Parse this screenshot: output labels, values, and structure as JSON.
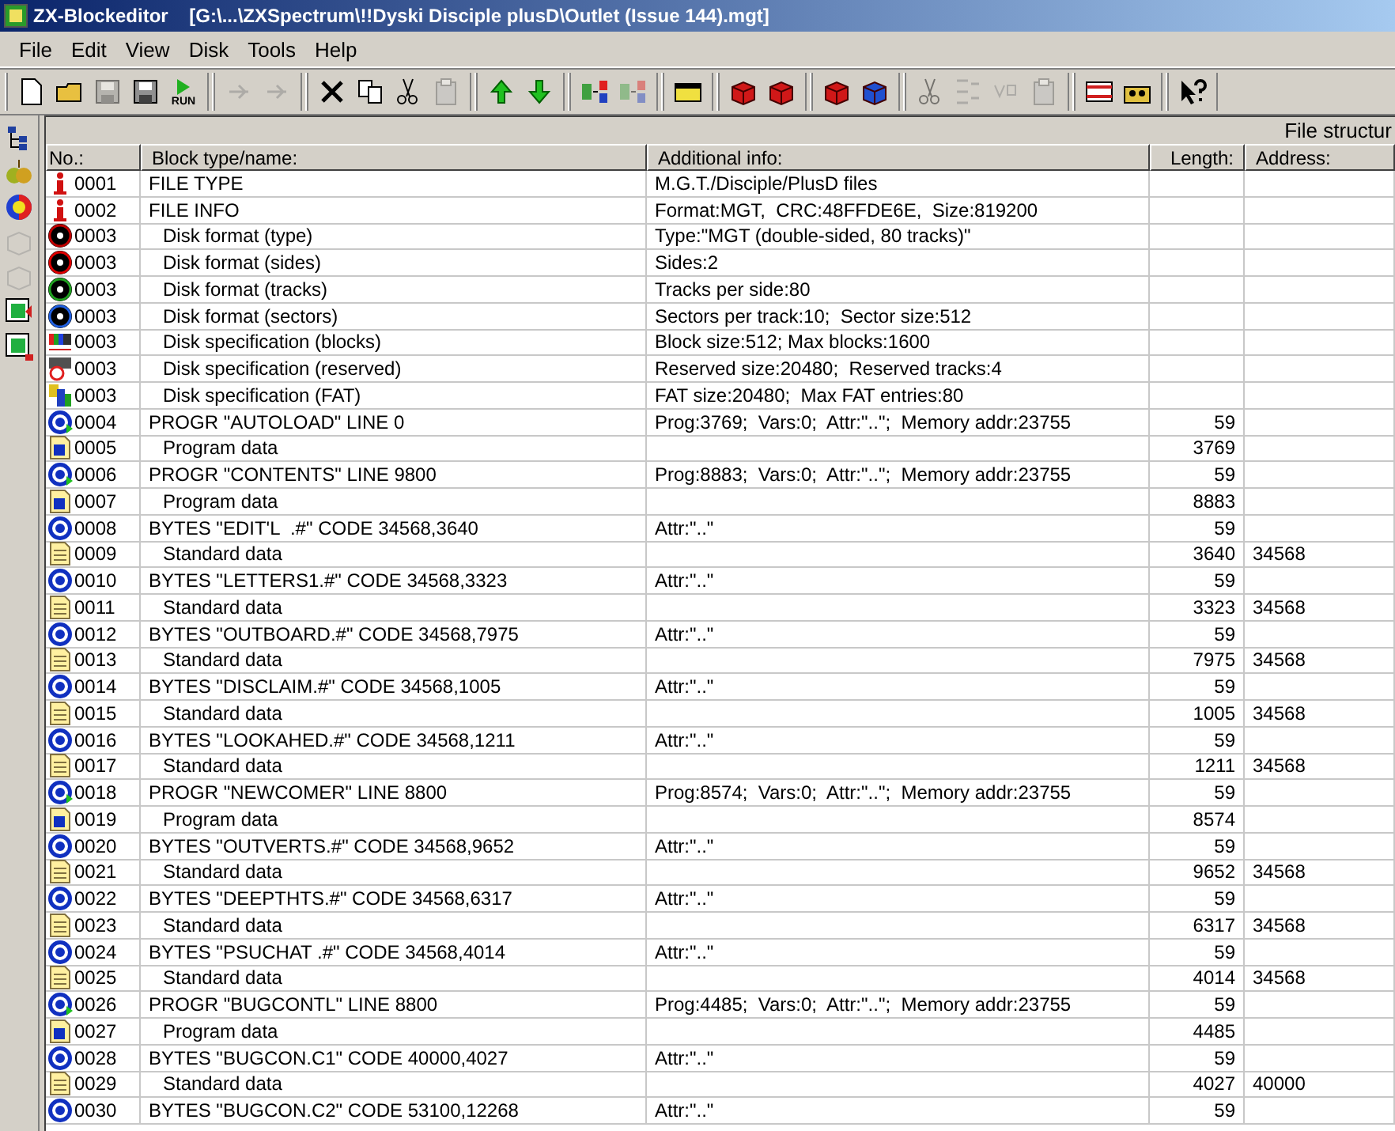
{
  "window": {
    "title": "ZX-Blockeditor    [G:\\...\\ZXSpectrum\\!!Dyski Disciple plusD\\Outlet (Issue 144).mgt]"
  },
  "menu": [
    "File",
    "Edit",
    "View",
    "Disk",
    "Tools",
    "Help"
  ],
  "toolbar": [
    [
      {
        "kind": "new",
        "disabled": false
      },
      {
        "kind": "open",
        "disabled": false
      },
      {
        "kind": "save",
        "disabled": true
      },
      {
        "kind": "save-all",
        "disabled": false
      },
      {
        "kind": "run",
        "label": "RUN",
        "disabled": false
      }
    ],
    [
      {
        "kind": "undo",
        "disabled": true
      },
      {
        "kind": "redo",
        "disabled": true
      }
    ],
    [
      {
        "kind": "delete",
        "disabled": false
      },
      {
        "kind": "copy",
        "disabled": false
      },
      {
        "kind": "cut",
        "disabled": false
      },
      {
        "kind": "paste",
        "disabled": true
      }
    ],
    [
      {
        "kind": "up",
        "disabled": false
      },
      {
        "kind": "down",
        "disabled": false
      }
    ],
    [
      {
        "kind": "split",
        "disabled": false
      },
      {
        "kind": "join",
        "disabled": true
      }
    ],
    [
      {
        "kind": "tape",
        "disabled": false
      }
    ],
    [
      {
        "kind": "box-add",
        "disabled": false
      },
      {
        "kind": "box-clock",
        "disabled": false
      }
    ],
    [
      {
        "kind": "box-edit",
        "disabled": false
      },
      {
        "kind": "box-blue",
        "disabled": false
      }
    ],
    [
      {
        "kind": "cut-clock",
        "disabled": true
      },
      {
        "kind": "list",
        "disabled": true
      },
      {
        "kind": "vo",
        "disabled": true
      },
      {
        "kind": "clip-clock",
        "disabled": true
      }
    ],
    [
      {
        "kind": "ruler",
        "disabled": false
      },
      {
        "kind": "tape2",
        "disabled": false
      }
    ],
    [
      {
        "kind": "help",
        "disabled": false
      }
    ]
  ],
  "left_toolbar": [
    {
      "kind": "tree",
      "disabled": false
    },
    {
      "kind": "pears",
      "disabled": false
    },
    {
      "kind": "ball",
      "disabled": false
    },
    {
      "kind": "box",
      "disabled": true
    },
    {
      "kind": "box",
      "disabled": true
    },
    {
      "kind": "green-in",
      "disabled": false
    },
    {
      "kind": "green-out",
      "disabled": false
    }
  ],
  "panel": {
    "title": "File structur"
  },
  "table": {
    "columns": [
      "No.:",
      "Block type/name:",
      "Additional info:",
      "Length:",
      "Address:"
    ],
    "rows": [
      {
        "kind": "info",
        "no": "0001",
        "name": "FILE TYPE",
        "info": "M.G.T./Disciple/PlusD files"
      },
      {
        "kind": "info",
        "no": "0002",
        "name": "FILE INFO",
        "info": "Format:MGT,  CRC:48FFDE6E,  Size:819200",
        "children": [
          {
            "kind": "disk-type",
            "no": "0003",
            "name": "Disk format (type)",
            "info": "Type:\"MGT (double-sided, 80 tracks)\""
          },
          {
            "kind": "disk-sides",
            "no": "0003",
            "name": "Disk format (sides)",
            "info": "Sides:2"
          },
          {
            "kind": "disk-tracks",
            "no": "0003",
            "name": "Disk format (tracks)",
            "info": "Tracks per side:80"
          },
          {
            "kind": "disk-sectors",
            "no": "0003",
            "name": "Disk format (sectors)",
            "info": "Sectors per track:10;  Sector size:512"
          },
          {
            "kind": "spec-blocks",
            "no": "0003",
            "name": "Disk specification (blocks)",
            "info": "Block size:512; Max blocks:1600"
          },
          {
            "kind": "spec-reserved",
            "no": "0003",
            "name": "Disk specification (reserved)",
            "info": "Reserved size:20480;  Reserved tracks:4"
          },
          {
            "kind": "spec-fat",
            "no": "0003",
            "name": "Disk specification (FAT)",
            "info": "FAT size:20480;  Max FAT entries:80"
          }
        ]
      },
      {
        "kind": "program",
        "no": "0004",
        "name": "PROGR \"AUTOLOAD\" LINE 0",
        "info": "Prog:3769;  Vars:0;  Attr:\"..\";  Memory addr:23755",
        "length": "59",
        "children": [
          {
            "kind": "program-data",
            "no": "0005",
            "name": "Program data",
            "length": "3769"
          }
        ]
      },
      {
        "kind": "program",
        "no": "0006",
        "name": "PROGR \"CONTENTS\" LINE 9800",
        "info": "Prog:8883;  Vars:0;  Attr:\"..\";  Memory addr:23755",
        "length": "59",
        "children": [
          {
            "kind": "program-data",
            "no": "0007",
            "name": "Program data",
            "length": "8883"
          }
        ]
      },
      {
        "kind": "bytes",
        "no": "0008",
        "name": "BYTES \"EDIT'L  .#\" CODE 34568,3640",
        "info": "Attr:\"..\"",
        "length": "59",
        "children": [
          {
            "kind": "data",
            "no": "0009",
            "name": "Standard data",
            "length": "3640",
            "address": "34568"
          }
        ]
      },
      {
        "kind": "bytes",
        "no": "0010",
        "name": "BYTES \"LETTERS1.#\" CODE 34568,3323",
        "info": "Attr:\"..\"",
        "length": "59",
        "children": [
          {
            "kind": "data",
            "no": "0011",
            "name": "Standard data",
            "length": "3323",
            "address": "34568"
          }
        ]
      },
      {
        "kind": "bytes",
        "no": "0012",
        "name": "BYTES \"OUTBOARD.#\" CODE 34568,7975",
        "info": "Attr:\"..\"",
        "length": "59",
        "children": [
          {
            "kind": "data",
            "no": "0013",
            "name": "Standard data",
            "length": "7975",
            "address": "34568"
          }
        ]
      },
      {
        "kind": "bytes",
        "no": "0014",
        "name": "BYTES \"DISCLAIM.#\" CODE 34568,1005",
        "info": "Attr:\"..\"",
        "length": "59",
        "children": [
          {
            "kind": "data",
            "no": "0015",
            "name": "Standard data",
            "length": "1005",
            "address": "34568"
          }
        ]
      },
      {
        "kind": "bytes",
        "no": "0016",
        "name": "BYTES \"LOOKAHED.#\" CODE 34568,1211",
        "info": "Attr:\"..\"",
        "length": "59",
        "children": [
          {
            "kind": "data",
            "no": "0017",
            "name": "Standard data",
            "length": "1211",
            "address": "34568"
          }
        ]
      },
      {
        "kind": "program",
        "no": "0018",
        "name": "PROGR \"NEWCOMER\" LINE 8800",
        "info": "Prog:8574;  Vars:0;  Attr:\"..\";  Memory addr:23755",
        "length": "59",
        "children": [
          {
            "kind": "program-data",
            "no": "0019",
            "name": "Program data",
            "length": "8574"
          }
        ]
      },
      {
        "kind": "bytes",
        "no": "0020",
        "name": "BYTES \"OUTVERTS.#\" CODE 34568,9652",
        "info": "Attr:\"..\"",
        "length": "59",
        "children": [
          {
            "kind": "data",
            "no": "0021",
            "name": "Standard data",
            "length": "9652",
            "address": "34568"
          }
        ]
      },
      {
        "kind": "bytes",
        "no": "0022",
        "name": "BYTES \"DEEPTHTS.#\" CODE 34568,6317",
        "info": "Attr:\"..\"",
        "length": "59",
        "children": [
          {
            "kind": "data",
            "no": "0023",
            "name": "Standard data",
            "length": "6317",
            "address": "34568"
          }
        ]
      },
      {
        "kind": "bytes",
        "no": "0024",
        "name": "BYTES \"PSUCHAT .#\" CODE 34568,4014",
        "info": "Attr:\"..\"",
        "length": "59",
        "children": [
          {
            "kind": "data",
            "no": "0025",
            "name": "Standard data",
            "length": "4014",
            "address": "34568"
          }
        ]
      },
      {
        "kind": "program",
        "no": "0026",
        "name": "PROGR \"BUGCONTL\" LINE 8800",
        "info": "Prog:4485;  Vars:0;  Attr:\"..\";  Memory addr:23755",
        "length": "59",
        "children": [
          {
            "kind": "program-data",
            "no": "0027",
            "name": "Program data",
            "length": "4485"
          }
        ]
      },
      {
        "kind": "bytes",
        "no": "0028",
        "name": "BYTES \"BUGCON.C1\" CODE 40000,4027",
        "info": "Attr:\"..\"",
        "length": "59",
        "children": [
          {
            "kind": "data",
            "no": "0029",
            "name": "Standard data",
            "length": "4027",
            "address": "40000"
          }
        ]
      },
      {
        "kind": "bytes",
        "no": "0030",
        "name": "BYTES \"BUGCON.C2\" CODE 53100,12268",
        "info": "Attr:\"..\"",
        "length": "59"
      }
    ]
  }
}
